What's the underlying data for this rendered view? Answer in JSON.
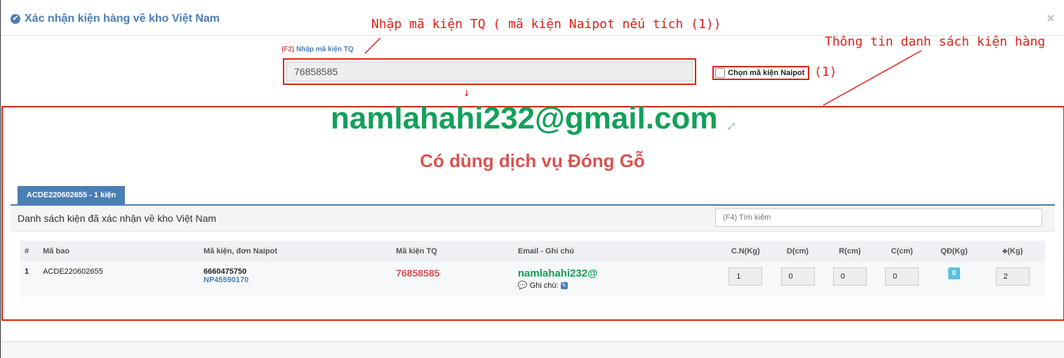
{
  "modal": {
    "title": "Xác nhận kiện hàng về kho Việt Nam",
    "close": "×"
  },
  "annotations": {
    "top": "Nhập mã kiện TQ ( mã kiện Naipot nếu tích (1))",
    "right": "Thông tin danh sách kiện hàng",
    "one": "(1)",
    "arrow_down": "↓"
  },
  "scan": {
    "hotkey": "(F2)",
    "label": "Nhập mã kiện TQ",
    "value": "76858585",
    "checkbox_label": "Chọn mã kiện Naipot",
    "checkbox_checked": false
  },
  "customer": {
    "email": "namlahahi232@gmail.com",
    "wood_service": "Có dùng dịch vụ Đóng Gỗ"
  },
  "tab": {
    "label": "ACDE220602655 - 1 kiện"
  },
  "panel": {
    "title": "Danh sách kiện đã xác nhận về kho Việt Nam",
    "search_placeholder": "(F4) Tìm kiếm"
  },
  "table": {
    "headers": [
      "#",
      "Mã bao",
      "Mã kiện, đơn Naipot",
      "Mã kiện TQ",
      "Email - Ghi chú",
      "C.N(Kg)",
      "D(cm)",
      "R(cm)",
      "C(cm)",
      "QĐ(Kg)",
      "(Kg)"
    ],
    "rows": [
      {
        "index": "1",
        "bag": "ACDE220602655",
        "package": "6660475750",
        "order": "NP45590170",
        "tq_code": "76858585",
        "email": "namlahahi232@",
        "note_label": "Ghi chú:",
        "weight": "1",
        "length": "0",
        "width": "0",
        "height": "0",
        "converted": "0",
        "tree_kg": "2"
      }
    ]
  },
  "colors": {
    "accent": "#4a7fb5",
    "highlight_red": "#d21",
    "email_green": "#13a05a",
    "danger": "#d9534f"
  }
}
